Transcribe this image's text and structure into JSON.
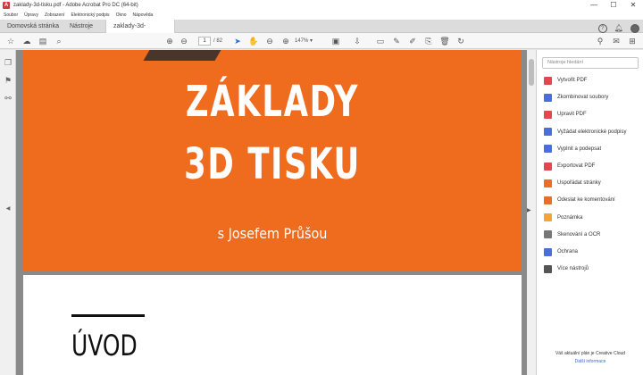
{
  "window": {
    "title": "zaklady-3d-tisku.pdf - Adobe Acrobat Pro DC (64-bit)",
    "minimize": "—",
    "maximize": "☐",
    "close": "✕"
  },
  "menu": [
    "Soubor",
    "Úpravy",
    "Zobrazení",
    "Elektronický podpis",
    "Okno",
    "Nápověda"
  ],
  "tabs": {
    "home": "Domovská stránka",
    "tools": "Nástroje",
    "doc": "zaklady-3d-tisku.pdf",
    "close": "×"
  },
  "toolbar": {
    "page_current": "1",
    "page_total": "/ 82",
    "zoom": "147%"
  },
  "slide": {
    "line1": "ZÁKLADY",
    "line2": "3D TISKU",
    "line3": "s Josefem Průšou",
    "bg": "#ef6b1e"
  },
  "page2": {
    "heading": "ÚVOD"
  },
  "panel": {
    "search_placeholder": "Nástroje hledání",
    "tools": [
      {
        "label": "Vytvořit PDF",
        "color": "#e34850"
      },
      {
        "label": "Zkombinovat soubory",
        "color": "#4a6fd8"
      },
      {
        "label": "Upravit PDF",
        "color": "#e34850"
      },
      {
        "label": "Vyžádat elektronické podpisy",
        "color": "#4a6fd8"
      },
      {
        "label": "Vyplnit a podepsat",
        "color": "#4a6fd8"
      },
      {
        "label": "Exportovat PDF",
        "color": "#e34850"
      },
      {
        "label": "Uspořádat stránky",
        "color": "#e86f2a"
      },
      {
        "label": "Odeslat ke komentování",
        "color": "#e86f2a"
      },
      {
        "label": "Poznámka",
        "color": "#f0a43a"
      },
      {
        "label": "Skenování a OCR",
        "color": "#777777"
      },
      {
        "label": "Ochrana",
        "color": "#4a6fd8"
      },
      {
        "label": "Více nástrojů",
        "color": "#555555"
      }
    ],
    "footer_text": "Váš aktuální plán je Creative Cloud",
    "footer_link": "Další informace"
  }
}
